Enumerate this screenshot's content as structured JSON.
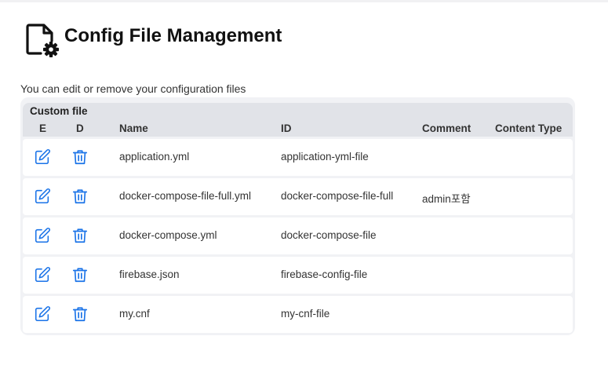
{
  "page": {
    "title": "Config File Management",
    "subtitle": "You can edit or remove your configuration files",
    "icon": "file-settings-icon"
  },
  "table": {
    "group_label": "Custom file",
    "columns": {
      "edit": "E",
      "delete": "D",
      "name": "Name",
      "id": "ID",
      "comment": "Comment",
      "content_type": "Content Type"
    },
    "rows": [
      {
        "name": "application.yml",
        "id": "application-yml-file",
        "comment": "",
        "content_type": ""
      },
      {
        "name": "docker-compose-file-full.yml",
        "id": "docker-compose-file-full",
        "comment": "admin포함",
        "content_type": ""
      },
      {
        "name": "docker-compose.yml",
        "id": "docker-compose-file",
        "comment": "",
        "content_type": ""
      },
      {
        "name": "firebase.json",
        "id": "firebase-config-file",
        "comment": "",
        "content_type": ""
      },
      {
        "name": "my.cnf",
        "id": "my-cnf-file",
        "comment": "",
        "content_type": ""
      }
    ],
    "edit_icon": "edit-icon",
    "delete_icon": "trash-icon"
  },
  "colors": {
    "accent": "#1a73e8",
    "header_bg": "#e1e3e8",
    "card_bg": "#f1f2f5"
  }
}
